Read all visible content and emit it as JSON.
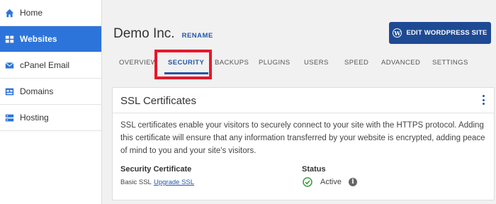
{
  "sidebar": {
    "items": [
      {
        "label": "Home",
        "icon": "home-icon"
      },
      {
        "label": "Websites",
        "icon": "websites-icon",
        "active": true
      },
      {
        "label": "cPanel Email",
        "icon": "email-icon"
      },
      {
        "label": "Domains",
        "icon": "domains-icon"
      },
      {
        "label": "Hosting",
        "icon": "hosting-icon"
      }
    ]
  },
  "header": {
    "site_name": "Demo Inc.",
    "rename_label": "RENAME",
    "edit_button_label": "EDIT WORDPRESS SITE"
  },
  "tabs": [
    {
      "label": "OVERVIEW"
    },
    {
      "label": "SECURITY",
      "active": true
    },
    {
      "label": "BACKUPS"
    },
    {
      "label": "PLUGINS"
    },
    {
      "label": "USERS"
    },
    {
      "label": "SPEED"
    },
    {
      "label": "ADVANCED"
    },
    {
      "label": "SETTINGS"
    }
  ],
  "ssl_card": {
    "title": "SSL Certificates",
    "description": "SSL certificates enable your visitors to securely connect to your site with the HTTPS protocol. Adding this certificate will ensure that any information transferred by your website is encrypted, adding peace of mind to you and your site's visitors.",
    "certificate_label": "Security Certificate",
    "certificate_value": "Basic SSL",
    "upgrade_label": "Upgrade SSL",
    "status_label": "Status",
    "status_value": "Active"
  },
  "colors": {
    "accent": "#2456a8",
    "sidebar_active": "#2d74da",
    "button": "#1e4a94",
    "highlight": "#e5182b",
    "status_ok": "#3a9a3a"
  }
}
